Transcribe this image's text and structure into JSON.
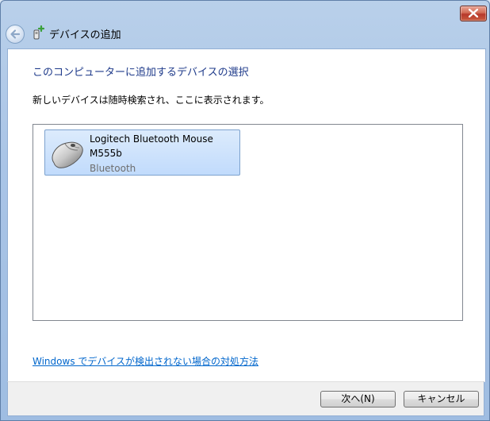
{
  "window": {
    "title": "デバイスの追加",
    "close_icon": "close-x-icon",
    "back_icon": "back-arrow-icon",
    "title_icon": "add-device-icon"
  },
  "main": {
    "heading": "このコンピューターに追加するデバイスの選択",
    "description": "新しいデバイスは随時検索され、ここに表示されます。",
    "devices": [
      {
        "name": "Logitech Bluetooth Mouse",
        "model": "M555b",
        "type": "Bluetooth",
        "icon": "mouse-icon"
      }
    ],
    "help_link": "Windows でデバイスが検出されない場合の対処方法"
  },
  "footer": {
    "next_label": "次へ(N)",
    "cancel_label": "キャンセル"
  },
  "colors": {
    "heading": "#1e3a8a",
    "link": "#0066cc",
    "selection": "#c1dbfc"
  }
}
